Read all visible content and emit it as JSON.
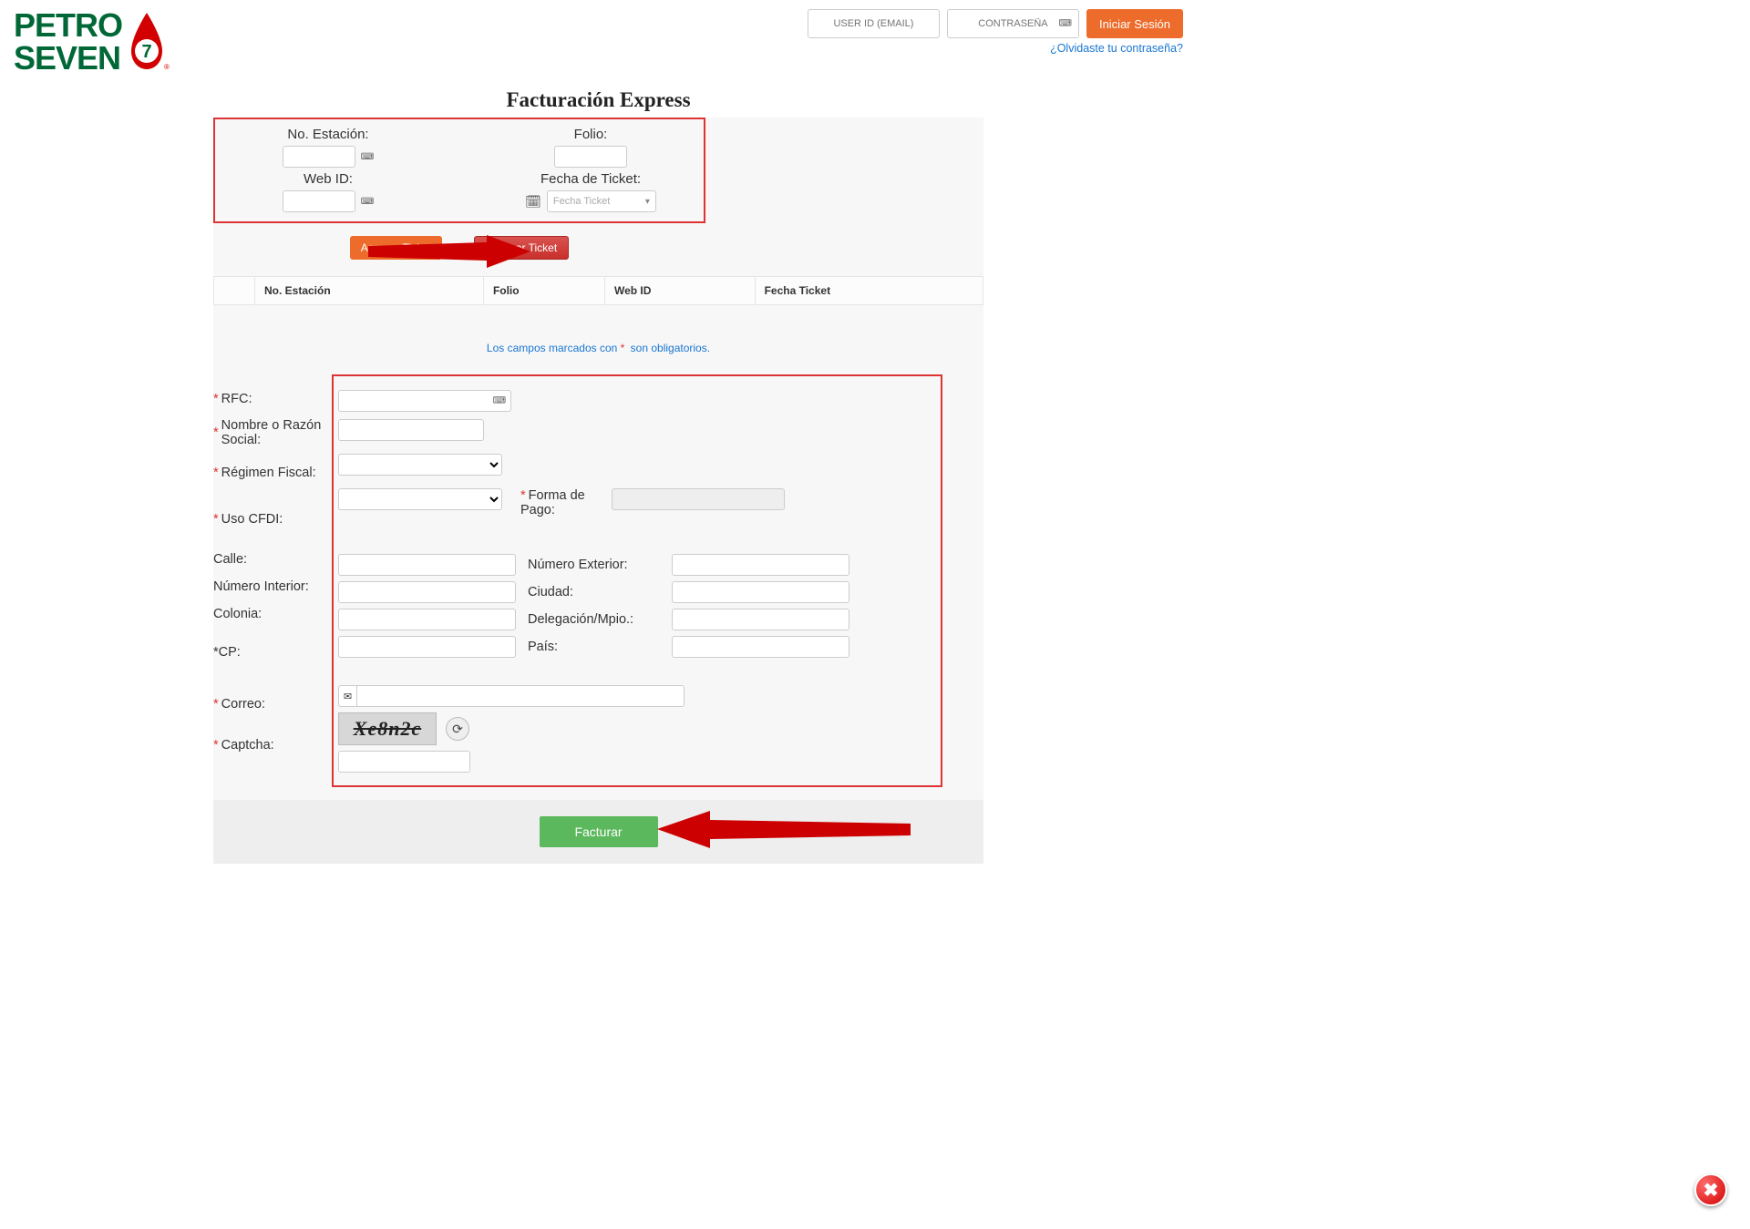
{
  "header": {
    "logo_line1": "PETRO",
    "logo_line2": "SEVEN",
    "logo_number": "7",
    "user_id_placeholder": "USER ID (EMAIL)",
    "password_placeholder": "CONTRASEÑA",
    "login_button": "Iniciar Sesión",
    "forgot_link": "¿Olvidaste tu contraseña?"
  },
  "page_title": "Facturación Express",
  "ticket_form": {
    "no_estacion_label": "No. Estación:",
    "web_id_label": "Web ID:",
    "folio_label": "Folio:",
    "fecha_ticket_label": "Fecha de Ticket:",
    "fecha_placeholder": "Fecha Ticket",
    "agregar_btn": "Agregar Ticket",
    "eliminar_btn": "Eliminar Ticket"
  },
  "tickets_table": {
    "cols": [
      "",
      "No. Estación",
      "Folio",
      "Web ID",
      "Fecha Ticket"
    ]
  },
  "required_note_prefix": "Los campos marcados con ",
  "required_note_suffix": " son obligatorios.",
  "form": {
    "rfc": "RFC:",
    "nombre": "Nombre o Razón Social:",
    "regimen": "Régimen Fiscal:",
    "uso_cfdi": "Uso CFDI:",
    "forma_pago": "Forma de Pago:",
    "calle": "Calle:",
    "numero_ext": "Número Exterior:",
    "numero_int": "Número Interior:",
    "ciudad": "Ciudad:",
    "colonia": "Colonia:",
    "delegacion": "Delegación/Mpio.:",
    "cp": "*CP:",
    "pais": "País:",
    "correo": "Correo:",
    "captcha": "Captcha:",
    "captcha_text": "Xe8n2c"
  },
  "footer": {
    "facturar_btn": "Facturar"
  }
}
